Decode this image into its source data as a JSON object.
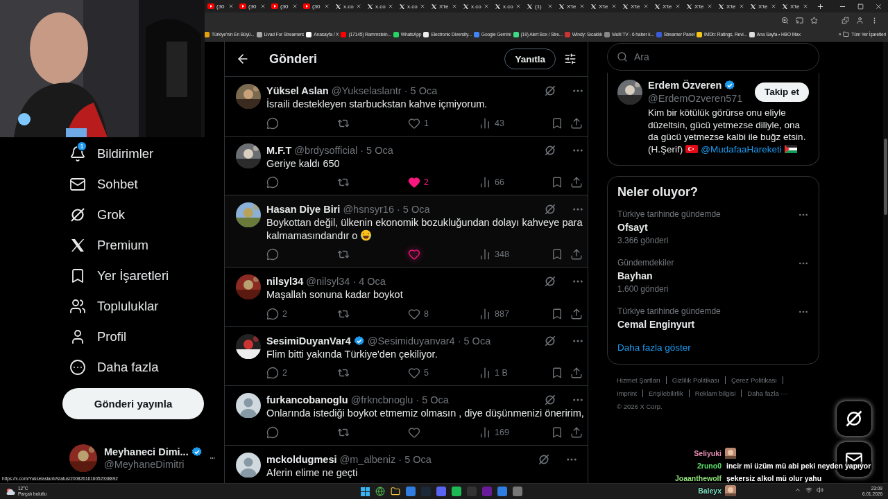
{
  "browser": {
    "tabs": [
      {
        "kind": "youtube",
        "label": "(30"
      },
      {
        "kind": "youtube",
        "label": "(30"
      },
      {
        "kind": "youtube",
        "label": "(30"
      },
      {
        "kind": "youtube",
        "label": "(30"
      },
      {
        "kind": "x",
        "label": "x.co"
      },
      {
        "kind": "x",
        "label": "x.co"
      },
      {
        "kind": "x",
        "label": "x.co"
      },
      {
        "kind": "x",
        "label": "X'te"
      },
      {
        "kind": "x",
        "label": "x.co"
      },
      {
        "kind": "x",
        "label": "x.co"
      },
      {
        "kind": "x",
        "label": "(1)"
      },
      {
        "kind": "x",
        "label": "X'te"
      },
      {
        "kind": "x",
        "label": "X'te"
      },
      {
        "kind": "x",
        "label": "X'te"
      },
      {
        "kind": "x",
        "label": "X'te"
      },
      {
        "kind": "x",
        "label": "X'te"
      },
      {
        "kind": "x",
        "label": "X'te"
      },
      {
        "kind": "x",
        "label": "X'te"
      },
      {
        "kind": "x",
        "label": "X'te"
      }
    ],
    "bookmarks": [
      "Türkiye'nin En Büyü...",
      "Livad For Streamers",
      "Anasayfa / X",
      "(17145) Rammstein...",
      "WhatsApp",
      "Electronic Diversity...",
      "Google Gemini",
      "(19) Alert Box / Stre...",
      "Windy: Sıcaklık",
      "Multi TV - 6 haber k...",
      "Streamer Panel",
      "IMDb: Ratings, Revi...",
      "Ana Sayfa • HBO Max"
    ],
    "bookmarks_more": "»",
    "all_bookmarks": "Tüm Yer İşaretleri"
  },
  "sidebar": {
    "items": [
      {
        "kind": "bell",
        "label": "Bildirimler",
        "badge": "1"
      },
      {
        "kind": "mail",
        "label": "Sohbet"
      },
      {
        "kind": "grok",
        "label": "Grok"
      },
      {
        "kind": "x",
        "label": "Premium"
      },
      {
        "kind": "bookmark",
        "label": "Yer İşaretleri"
      },
      {
        "kind": "people",
        "label": "Topluluklar"
      },
      {
        "kind": "person",
        "label": "Profil"
      },
      {
        "kind": "more",
        "label": "Daha fazla"
      }
    ],
    "post_button": "Gönderi yayınla",
    "account": {
      "name": "Meyhaneci Dimi...",
      "verified": true,
      "handle": "@MeyhaneDimitri"
    }
  },
  "header": {
    "title": "Gönderi",
    "reply_button": "Yanıtla"
  },
  "tweets": [
    {
      "name": "Yüksel Aslan",
      "verified": false,
      "handle": "@Yukselaslantr",
      "dot": "·",
      "date": "5 Oca",
      "text": "İsraili destekleyen starbuckstan kahve içmiyorum.",
      "likes": "1",
      "views": "43",
      "liked": false,
      "hover": false
    },
    {
      "name": "M.F.T",
      "verified": false,
      "handle": "@brdysofficial",
      "dot": "·",
      "date": "5 Oca",
      "text": "Geriye kaldı 650",
      "likes": "2",
      "views": "66",
      "liked": true,
      "hover": false
    },
    {
      "name": "Hasan Diye Biri",
      "verified": false,
      "handle": "@hsnsyr16",
      "dot": "·",
      "date": "5 Oca",
      "text": "Boykottan değil, ülkenin ekonomik bozukluğundan dolayı kahveye para kalmamasındandır o",
      "emoji": {
        "kind": "laughing"
      },
      "views": "348",
      "liked": false,
      "hover": true
    },
    {
      "name": "nilsyl34",
      "verified": false,
      "handle": "@nilsyl34",
      "dot": "·",
      "date": "4 Oca",
      "text": "Maşallah sonuna kadar boykot",
      "replies": "2",
      "likes": "8",
      "views": "887",
      "liked": false,
      "hover": false
    },
    {
      "name": "SesimiDuyanVar4",
      "verified": true,
      "handle": "@Sesimiduyanvar4",
      "dot": "·",
      "date": "5 Oca",
      "text": "Flim bitti yakında Türkiye'den çekiliyor.",
      "replies": "2",
      "likes": "5",
      "views": "1 B",
      "liked": false,
      "hover": false
    },
    {
      "avatar": {
        "kind": "default"
      },
      "name": "furkancobanoglu",
      "verified": false,
      "handle": "@frkncbnoglu",
      "dot": "·",
      "date": "5 Oca",
      "text": "Onlarında istediği boykot etmemiz olmasın , diye düşünmenizi öneririm,",
      "views": "169",
      "liked": false,
      "hover": false
    },
    {
      "avatar": {
        "kind": "default"
      },
      "name": "mckoldugmesi",
      "verified": false,
      "handle": "@m_albeniz",
      "dot": "·",
      "date": "5 Oca",
      "text": "Aferin elime ne geçti"
    }
  ],
  "right": {
    "search": {
      "placeholder": "Ara"
    },
    "profile": {
      "name": "Erdem Özveren",
      "verified": true,
      "handle": "@ErdemOzveren571",
      "follow_button": "Takip et",
      "bio": "Kim bir kötülük görürse onu eliyle düzeltsin, gücü yetmezse diliyle, ona da gücü yetmezse kalbi ile buğz etsin. (H.Şerif)",
      "mention": "@MudafaaHareketi"
    },
    "trends": {
      "title": "Neler oluyor?",
      "items": [
        {
          "category": "Türkiye tarihinde gündemde",
          "topic": "Ofsayt",
          "count": "3.366 gönderi"
        },
        {
          "category": "Gündemdekiler",
          "topic": "Bayhan",
          "count": "1.600 gönderi"
        },
        {
          "category": "Türkiye tarihinde gündemde",
          "topic": "Cemal Enginyurt"
        }
      ],
      "show_more": "Daha fazla göster"
    },
    "footer": {
      "links": [
        "Hizmet Şartları",
        "Gizlilik Politikası",
        "Çerez Politikası",
        "Imprint",
        "Erişilebilirlik",
        "Reklam bilgisi",
        "Daha fazla ···"
      ],
      "copyright": "© 2026 X Corp."
    }
  },
  "status_url": "https://x.com/Yukselaslantr/status/2008261616052338892",
  "chat": [
    {
      "user": "Seliyuki",
      "color": "#e58fb0",
      "emote": true
    },
    {
      "user": "2runo0",
      "color": "#5be36b",
      "message": "incir mi üzüm mü abi peki neyden yapıyor"
    },
    {
      "user": "Joaanthewolf",
      "color": "#8fe07a",
      "message": "şekersiz alkol mü olur yahu"
    },
    {
      "user": "Baleyx",
      "color": "#7fe3c4",
      "emote": true
    }
  ],
  "taskbar": {
    "temperature": "12°C",
    "weather": "Parçalı bulutlu",
    "time": "23:09",
    "date": "6.01.2026"
  }
}
